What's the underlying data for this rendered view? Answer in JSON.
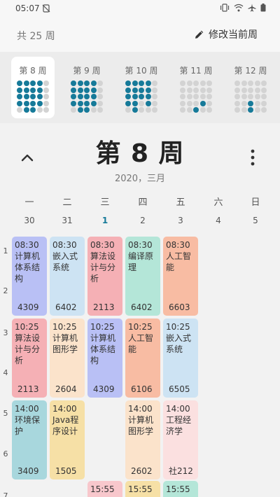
{
  "status": {
    "time": "05:07"
  },
  "header": {
    "total_weeks": "共 25 周",
    "edit_label": "修改当前周"
  },
  "weeks": [
    {
      "label": "第 8 周",
      "active": true,
      "dots": [
        1,
        1,
        1,
        1,
        0,
        1,
        1,
        1,
        1,
        0,
        1,
        1,
        1,
        1,
        0,
        1,
        1,
        1,
        1,
        0,
        0,
        1,
        1,
        0,
        0
      ]
    },
    {
      "label": "第 9 周",
      "active": false,
      "dots": [
        1,
        1,
        1,
        1,
        0,
        1,
        1,
        1,
        1,
        0,
        1,
        1,
        1,
        1,
        0,
        1,
        1,
        1,
        1,
        0,
        0,
        1,
        1,
        0,
        0
      ]
    },
    {
      "label": "第 10 周",
      "active": false,
      "dots": [
        1,
        1,
        1,
        1,
        0,
        1,
        1,
        1,
        1,
        0,
        1,
        1,
        1,
        1,
        0,
        1,
        1,
        0,
        1,
        0,
        0,
        1,
        0,
        0,
        0
      ]
    },
    {
      "label": "第 11 周",
      "active": false,
      "dots": [
        0,
        0,
        0,
        0,
        0,
        0,
        0,
        0,
        0,
        0,
        0,
        0,
        0,
        0,
        0,
        0,
        0,
        0,
        1,
        0,
        0,
        0,
        1,
        0,
        0
      ]
    },
    {
      "label": "第 12 周",
      "active": false,
      "dots": [
        0,
        0,
        0,
        0,
        0,
        0,
        0,
        0,
        0,
        0,
        0,
        0,
        0,
        0,
        0,
        0,
        0,
        1,
        0,
        0,
        0,
        0,
        1,
        0,
        0
      ]
    }
  ],
  "main": {
    "title": "第 8 周",
    "subtitle": "2020，三月"
  },
  "days": [
    {
      "name": "一",
      "date": "30"
    },
    {
      "name": "二",
      "date": "31"
    },
    {
      "name": "三",
      "date": "1",
      "today": true
    },
    {
      "name": "四",
      "date": "2"
    },
    {
      "name": "五",
      "date": "3"
    },
    {
      "name": "六",
      "date": "4"
    },
    {
      "name": "日",
      "date": "5"
    }
  ],
  "periods": [
    "1",
    "2",
    "3",
    "4",
    "5",
    "6",
    "7"
  ],
  "courses": [
    {
      "day": 0,
      "slot": 0,
      "time": "08:30",
      "name": "计算机体系结构",
      "room": "4309",
      "color": "#b9c0f5"
    },
    {
      "day": 1,
      "slot": 0,
      "time": "08:30",
      "name": "嵌入式系统",
      "room": "6402",
      "color": "#cde3f3"
    },
    {
      "day": 2,
      "slot": 0,
      "time": "08:30",
      "name": "算法设计与分析",
      "room": "2113",
      "color": "#f5b0b5"
    },
    {
      "day": 3,
      "slot": 0,
      "time": "08:30",
      "name": "编译原理",
      "room": "6402",
      "color": "#b4e6d8"
    },
    {
      "day": 4,
      "slot": 0,
      "time": "08:30",
      "name": "人工智能",
      "room": "6603",
      "color": "#f8bca3"
    },
    {
      "day": 0,
      "slot": 1,
      "time": "10:25",
      "name": "算法设计与分析",
      "room": "2113",
      "color": "#f5b0b5"
    },
    {
      "day": 1,
      "slot": 1,
      "time": "10:25",
      "name": "计算机图形学",
      "room": "2604",
      "color": "#fbe3cb"
    },
    {
      "day": 2,
      "slot": 1,
      "time": "10:25",
      "name": "计算机体系结构",
      "room": "4309",
      "color": "#b9c0f5"
    },
    {
      "day": 3,
      "slot": 1,
      "time": "10:25",
      "name": "人工智能",
      "room": "6106",
      "color": "#f8bca3"
    },
    {
      "day": 4,
      "slot": 1,
      "time": "10:25",
      "name": "嵌入式系统",
      "room": "6505",
      "color": "#cde3f3"
    },
    {
      "day": 0,
      "slot": 2,
      "time": "14:00",
      "name": "环境保护",
      "room": "3409",
      "color": "#a8d7dd"
    },
    {
      "day": 1,
      "slot": 2,
      "time": "14:00",
      "name": "Java程序设计",
      "room": "1505",
      "color": "#f6e0a6"
    },
    {
      "day": 3,
      "slot": 2,
      "time": "14:00",
      "name": "计算机图形学",
      "room": "2602",
      "color": "#fbe3cb"
    },
    {
      "day": 4,
      "slot": 2,
      "time": "14:00",
      "name": "工程经济学",
      "room": "社212",
      "color": "#fbe0e0"
    },
    {
      "day": 2,
      "slot": 3,
      "time": "15:55",
      "name": "",
      "room": "",
      "color": "#f8c7cc"
    },
    {
      "day": 3,
      "slot": 3,
      "time": "15:55",
      "name": "",
      "room": "",
      "color": "#f6e0a6"
    },
    {
      "day": 4,
      "slot": 3,
      "time": "15:55",
      "name": "",
      "room": "",
      "color": "#b4e6d8"
    }
  ]
}
